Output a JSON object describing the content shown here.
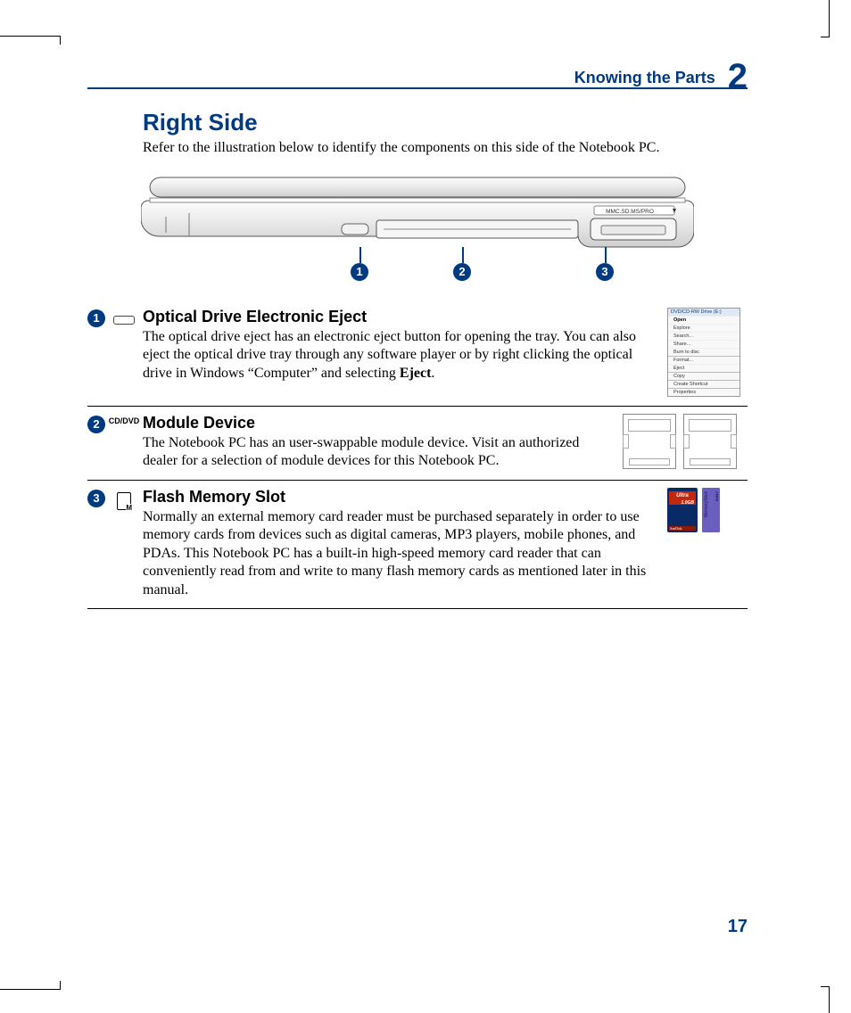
{
  "header": {
    "title": "Knowing the Parts",
    "chapter": "2"
  },
  "section": {
    "title": "Right Side",
    "intro": "Refer to the illustration below to identify the components on this side of the Notebook PC."
  },
  "slot_label": "MMC.SD.MS/PRO",
  "callouts": [
    "1",
    "2",
    "3"
  ],
  "items": [
    {
      "num": "1",
      "icon_kind": "eject",
      "title": "Optical Drive Electronic Eject",
      "body_pre": "The optical drive eject has an electronic eject button for opening the tray. You can also eject the optical drive tray through any software player or by right clicking the optical drive in Windows “Computer” and selecting ",
      "body_bold": "Eject",
      "body_post": ".",
      "side": "menu"
    },
    {
      "num": "2",
      "icon_kind": "cddvd",
      "icon_text": "CD/DVD",
      "title": "Module Device",
      "body": "The Notebook PC has an user-swappable module device. Visit an authorized dealer for a selection of module devices for this Notebook PC.",
      "side": "drives"
    },
    {
      "num": "3",
      "icon_kind": "flash",
      "title": "Flash Memory Slot",
      "body": "Normally an external memory card reader must be purchased separately in order to use memory cards from devices such as digital cameras, MP3 players, mobile phones, and PDAs. This Notebook PC has a built-in high-speed memory card reader that can conveniently read from and write to many flash memory cards as mentioned later in this manual.",
      "side": "cards"
    }
  ],
  "context_menu": {
    "header": "DVD/CD-RW Drive (E:)",
    "items": [
      "Open",
      "Explore",
      "Search...",
      "Share...",
      "Burn to disc",
      "Format...",
      "Eject",
      "Copy",
      "Create Shortcut",
      "Properties"
    ]
  },
  "sdcard": {
    "brand": "Ultra",
    "cap": "1.0GB",
    "vendor": "SanDisk"
  },
  "mstick": {
    "label": "MemoryStick",
    "vendor": "SONY"
  },
  "page_number": "17"
}
